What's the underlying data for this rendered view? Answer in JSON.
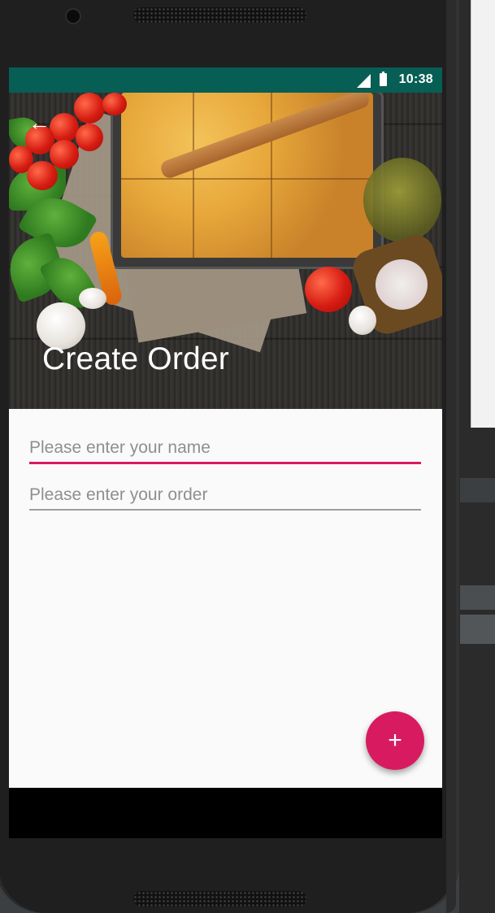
{
  "statusbar": {
    "time": "10:38"
  },
  "toolbar": {
    "title": "Create Order",
    "back_icon": "arrow-left-icon"
  },
  "form": {
    "name_field": {
      "placeholder": "Please enter your name",
      "value": ""
    },
    "order_field": {
      "placeholder": "Please enter your order",
      "value": ""
    }
  },
  "fab": {
    "label": "+",
    "icon": "plus-icon"
  },
  "colors": {
    "status_bar": "#075e54",
    "accent": "#d81b60",
    "background": "#fafafa"
  }
}
